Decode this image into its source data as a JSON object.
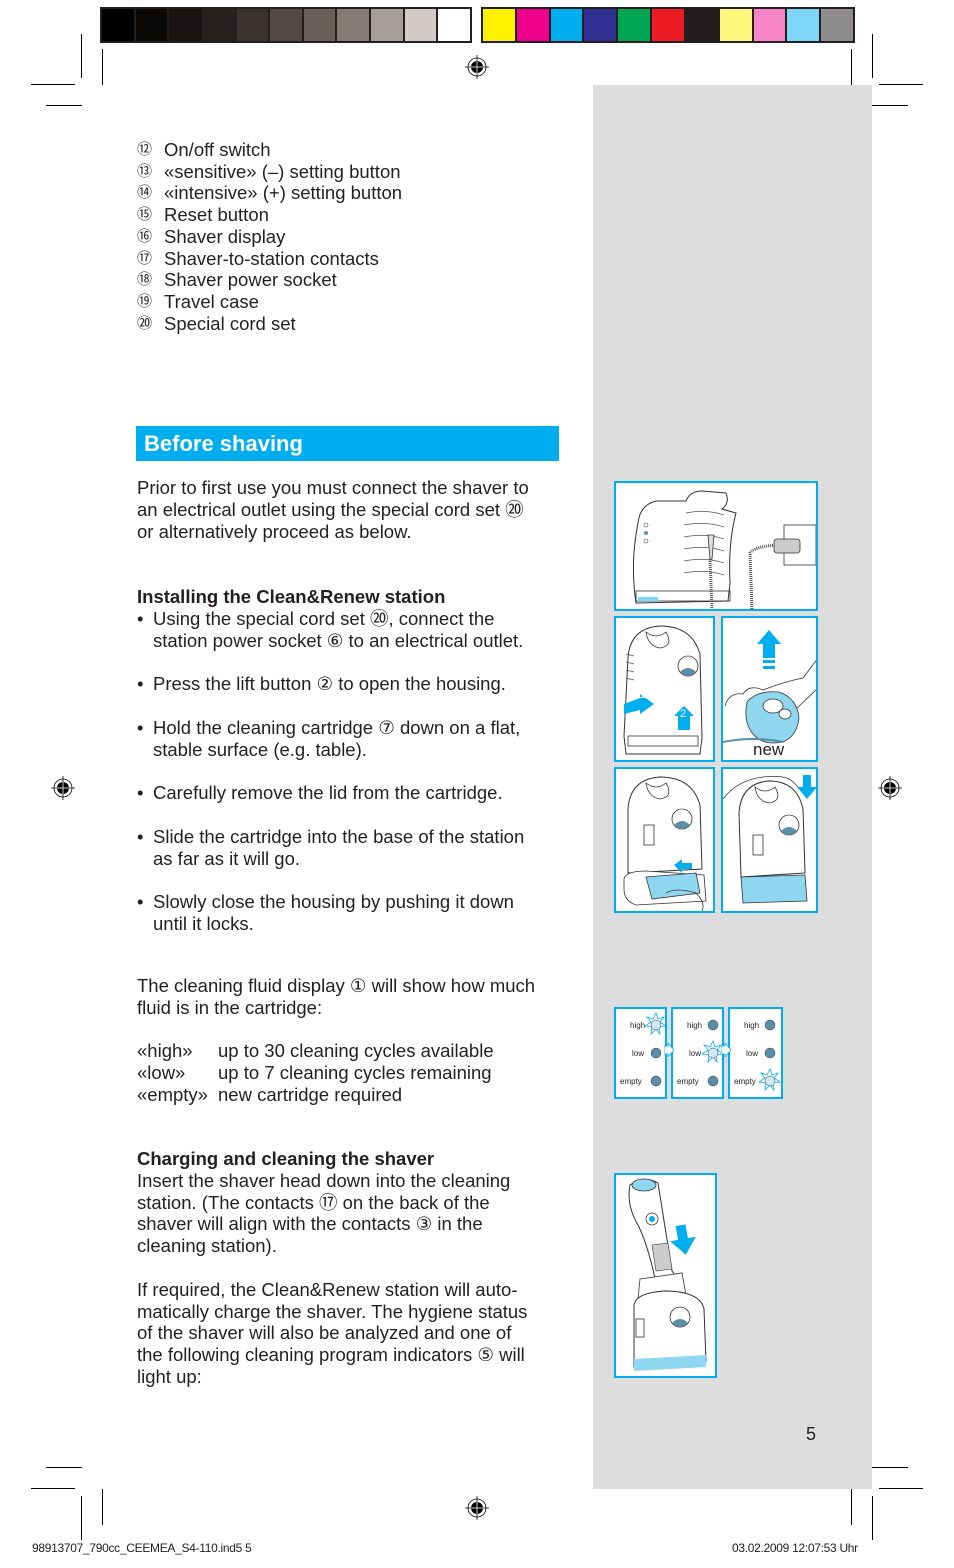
{
  "color_bar": {
    "grays": [
      "#000000",
      "#0b0907",
      "#181413",
      "#25211e",
      "#3a3230",
      "#524845",
      "#6a5f5b",
      "#857a75",
      "#a69e9b",
      "#d2cbca",
      "#ffffff"
    ],
    "process": [
      "#fff200",
      "#ec008c",
      "#00aeef",
      "#2e3192",
      "#00a651",
      "#ed1c24",
      "#231f20",
      "#fff77d",
      "#f785c8",
      "#7fd7f7",
      "#8e8c8c"
    ]
  },
  "parts_legend": [
    {
      "num": "⑫",
      "label": "On/off switch"
    },
    {
      "num": "⑬",
      "label": "«sensitive» (–) setting button"
    },
    {
      "num": "⑭",
      "label": "«intensive» (+) setting button"
    },
    {
      "num": "⑮",
      "label": "Reset button"
    },
    {
      "num": "⑯",
      "label": "Shaver display"
    },
    {
      "num": "⑰",
      "label": "Shaver-to-station contacts"
    },
    {
      "num": "⑱",
      "label": "Shaver power socket"
    },
    {
      "num": "⑲",
      "label": "Travel case"
    },
    {
      "num": "⑳",
      "label": "Special cord set"
    }
  ],
  "section": {
    "title": "Before shaving",
    "accent_color": "#00aeef"
  },
  "intro": {
    "lines": [
      "Prior to first use you must connect the shaver to",
      "an electrical outlet using the special cord set ⑳",
      "or alternatively proceed as below."
    ]
  },
  "installing": {
    "heading": "Installing the Clean&Renew station",
    "bullets": [
      {
        "lines": [
          "Using the special cord set ⑳, connect the",
          "station power socket ⑥ to an electrical outlet."
        ]
      },
      {
        "lines": [
          "Press the lift button ② to open the housing."
        ]
      },
      {
        "lines": [
          "Hold the cleaning cartridge ⑦ down on a flat,",
          "stable surface (e.g. table)."
        ]
      },
      {
        "lines": [
          "Carefully remove the lid from the cartridge."
        ]
      },
      {
        "lines": [
          "Slide the cartridge into the base of the station",
          "as far as it will go."
        ]
      },
      {
        "lines": [
          "Slowly close the housing by pushing it down",
          "until it locks."
        ]
      }
    ]
  },
  "fluid_display": {
    "lines": [
      "The cleaning fluid display ① will show how much",
      "fluid is in the cartridge:"
    ],
    "levels": [
      {
        "key": "«high»",
        "desc": "up to 30 cleaning cycles available"
      },
      {
        "key": "«low»",
        "desc": "up to 7 cleaning cycles remaining"
      },
      {
        "key": "«empty»",
        "desc": "new cartridge required"
      }
    ]
  },
  "charging": {
    "heading": "Charging and cleaning the shaver",
    "para1": [
      "Insert the shaver head down into the cleaning",
      "station. (The contacts ⑰ on the back of the",
      "shaver will align with the contacts ③ in the",
      "cleaning station)."
    ],
    "para2": [
      "If required, the Clean&Renew station will auto-",
      "matically charge the shaver. The hygiene status",
      "of the shaver will also be analyzed and one of",
      "the following cleaning program indicators ⑤ will",
      "light up:"
    ]
  },
  "figures": {
    "cartridge_label": "new",
    "step_numbers": [
      "1",
      "2"
    ],
    "indicator_panels": [
      {
        "labels": [
          "high",
          "low",
          "empty"
        ],
        "lit": "high"
      },
      {
        "labels": [
          "high",
          "low",
          "empty"
        ],
        "lit": "low"
      },
      {
        "labels": [
          "high",
          "low",
          "empty"
        ],
        "lit": "empty"
      }
    ]
  },
  "page_number": "5",
  "slug": {
    "file": "98913707_790cc_CEEMEA_S4-110.ind5   5",
    "date": "03.02.2009   12:07:53 Uhr"
  }
}
